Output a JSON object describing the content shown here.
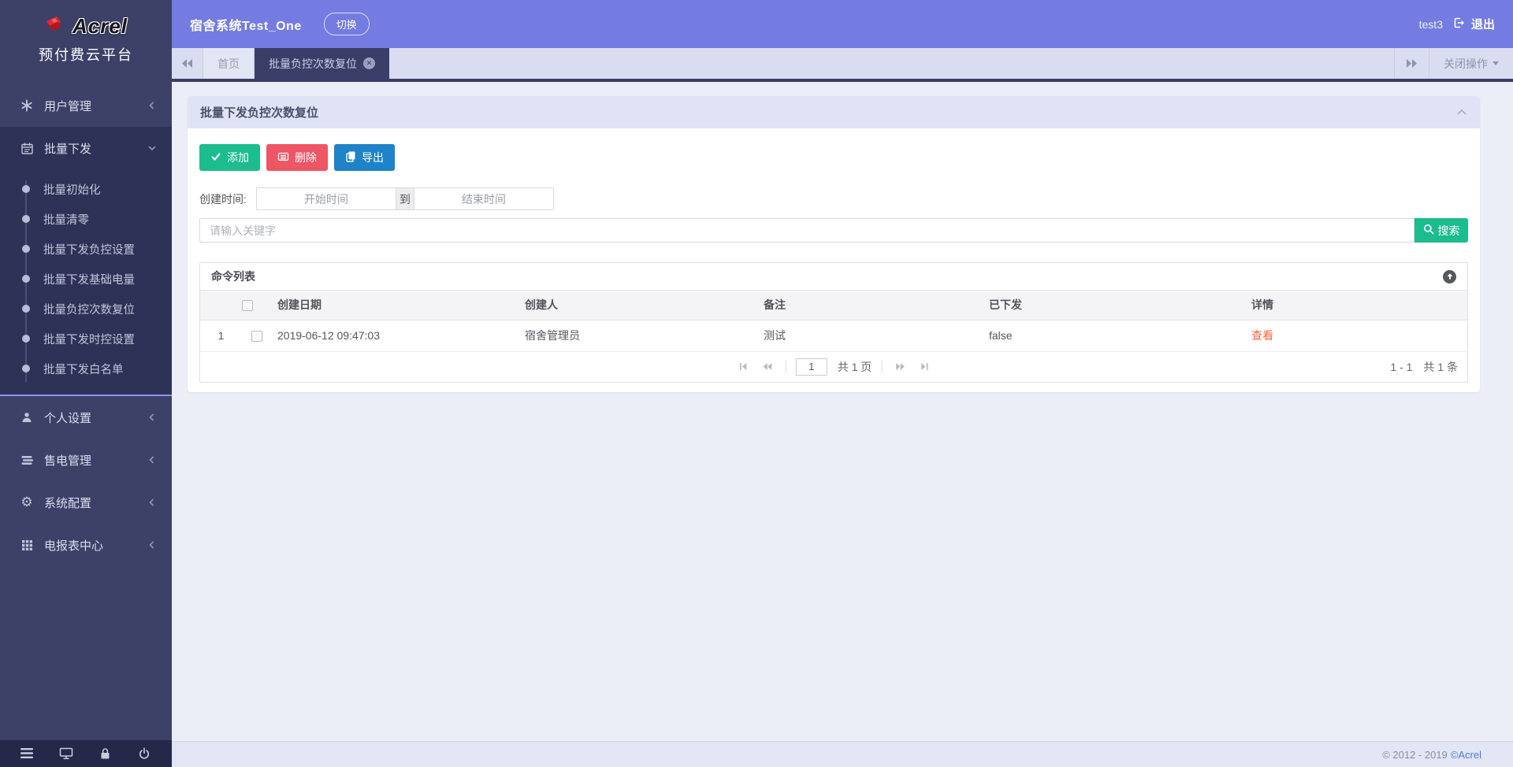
{
  "brand": {
    "logo_text": "Acrel",
    "platform_name": "预付费云平台"
  },
  "topbar": {
    "system_name": "宿舍系统Test_One",
    "switch_label": "切换",
    "username": "test3",
    "logout_label": "退出"
  },
  "tabbar": {
    "home_tab": "首页",
    "active_tab": "批量负控次数复位",
    "close_ops_label": "关闭操作"
  },
  "sidebar": {
    "items": [
      {
        "label": "用户管理",
        "icon": "asterisk-icon"
      },
      {
        "label": "批量下发",
        "icon": "calendar-icon",
        "children": [
          "批量初始化",
          "批量清零",
          "批量下发负控设置",
          "批量下发基础电量",
          "批量负控次数复位",
          "批量下发时控设置",
          "批量下发白名单"
        ]
      },
      {
        "label": "个人设置",
        "icon": "user-icon"
      },
      {
        "label": "售电管理",
        "icon": "bars-icon"
      },
      {
        "label": "系统配置",
        "icon": "gear-icon"
      },
      {
        "label": "电报表中心",
        "icon": "grid-icon"
      }
    ]
  },
  "panel": {
    "title": "批量下发负控次数复位",
    "toolbar": {
      "add": "添加",
      "delete": "删除",
      "export": "导出"
    },
    "filter": {
      "label": "创建时间:",
      "start_placeholder": "开始时间",
      "to": "到",
      "end_placeholder": "结束时间"
    },
    "search": {
      "placeholder": "请输入关键字",
      "button": "搜索"
    }
  },
  "table": {
    "title": "命令列表",
    "columns": [
      "创建日期",
      "创建人",
      "备注",
      "已下发",
      "详情"
    ],
    "rows": [
      {
        "index": "1",
        "date": "2019-06-12 09:47:03",
        "creator": "宿舍管理员",
        "remark": "测试",
        "sent": "false",
        "detail": "查看"
      }
    ],
    "pagination": {
      "page": "1",
      "pages_label": "共 1 页",
      "range": "1 - 1",
      "total": "共 1 条"
    }
  },
  "footer": {
    "copyright": "© 2012 - 2019",
    "brand": "©Acrel"
  },
  "colors": {
    "header_indigo": "#747ce2",
    "sidebar_navy": "#3d4168",
    "accent_green": "#1bbc8e",
    "accent_red": "#ee5565",
    "accent_blue": "#1e83c8",
    "link_orange": "#f4663e"
  }
}
